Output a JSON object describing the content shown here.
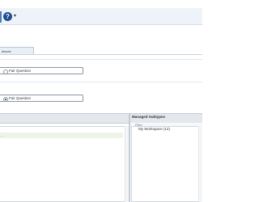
{
  "header": {
    "help_icon": "question-circle-icon",
    "help_glyph": "?",
    "caret_glyph": "▾"
  },
  "tab": {
    "label": "iences"
  },
  "options": {
    "first": {
      "label": "Fair Question",
      "selected": false
    },
    "second": {
      "label": "Fair Question",
      "selected": true
    }
  },
  "panels": {
    "right_title": "Managed Subtypes",
    "filter_label": "Filter",
    "workspace_label": "My Workspace (12)",
    "left_row_mark": "..."
  },
  "colors": {
    "topbar": "#eef3f9",
    "accent": "#1f4e8c",
    "selected_row": "#eef4e6",
    "panel_header": "#e4e8ed"
  }
}
